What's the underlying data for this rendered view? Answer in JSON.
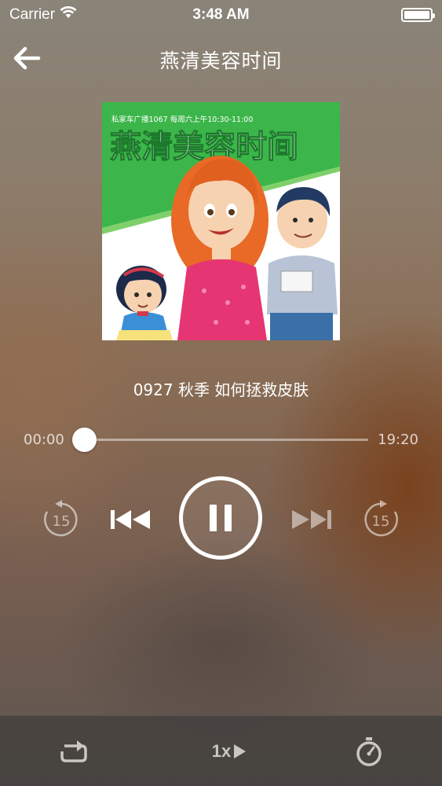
{
  "status_bar": {
    "carrier": "Carrier",
    "time": "3:48 AM",
    "battery_level": 1.0
  },
  "nav": {
    "title": "燕清美容时间",
    "back_icon": "arrow-left-icon"
  },
  "cover": {
    "banner_subtitle": "私家车广播1067 每周六上午10:30-11:00",
    "banner_title": "燕清美容时间",
    "colors": {
      "banner": "#3cb64a",
      "text": "#ffffff"
    }
  },
  "track": {
    "title": "0927 秋季 如何拯救皮肤"
  },
  "progress": {
    "current": "00:00",
    "total": "19:20",
    "fraction": 0.0
  },
  "controls": {
    "rewind_seconds": "15",
    "forward_seconds": "15",
    "state": "playing"
  },
  "bottom_bar": {
    "repeat_icon": "repeat-icon",
    "speed": "1x",
    "timer_icon": "timer-icon"
  }
}
